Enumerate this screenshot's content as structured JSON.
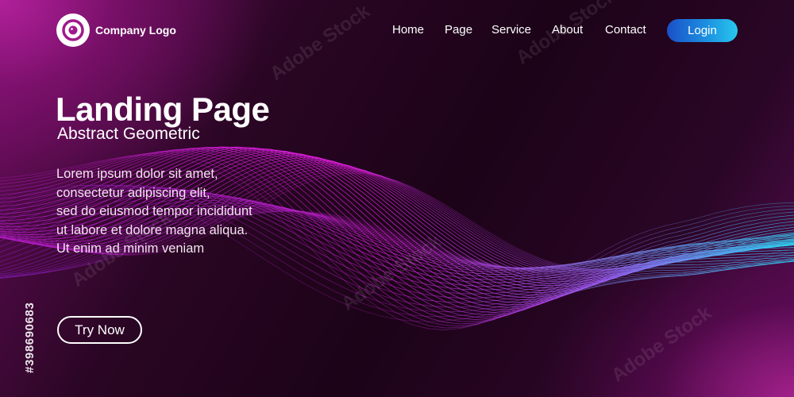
{
  "brand": {
    "logo_text": "Company Logo",
    "logo_icon": "logo-icon"
  },
  "nav": {
    "items": [
      "Home",
      "Page",
      "Service",
      "About",
      "Contact"
    ],
    "login_label": "Login"
  },
  "hero": {
    "title": "Landing Page",
    "subtitle": "Abstract Geometric",
    "body_lines": [
      "Lorem ipsum dolor sit amet,",
      "consectetur adipiscing elit,",
      "sed do eiusmod tempor incididunt",
      "ut labore et dolore magna aliqua.",
      "Ut enim ad minim veniam"
    ],
    "cta_label": "Try Now"
  },
  "stock": {
    "id_text": "#398690683",
    "watermark": "Adobe Stock"
  },
  "colors": {
    "background": "#1c0318",
    "accent_magenta": "#e21ee0",
    "accent_cyan": "#2ad8f5",
    "login_gradient": [
      "#1b50c8",
      "#27c7ee"
    ]
  }
}
